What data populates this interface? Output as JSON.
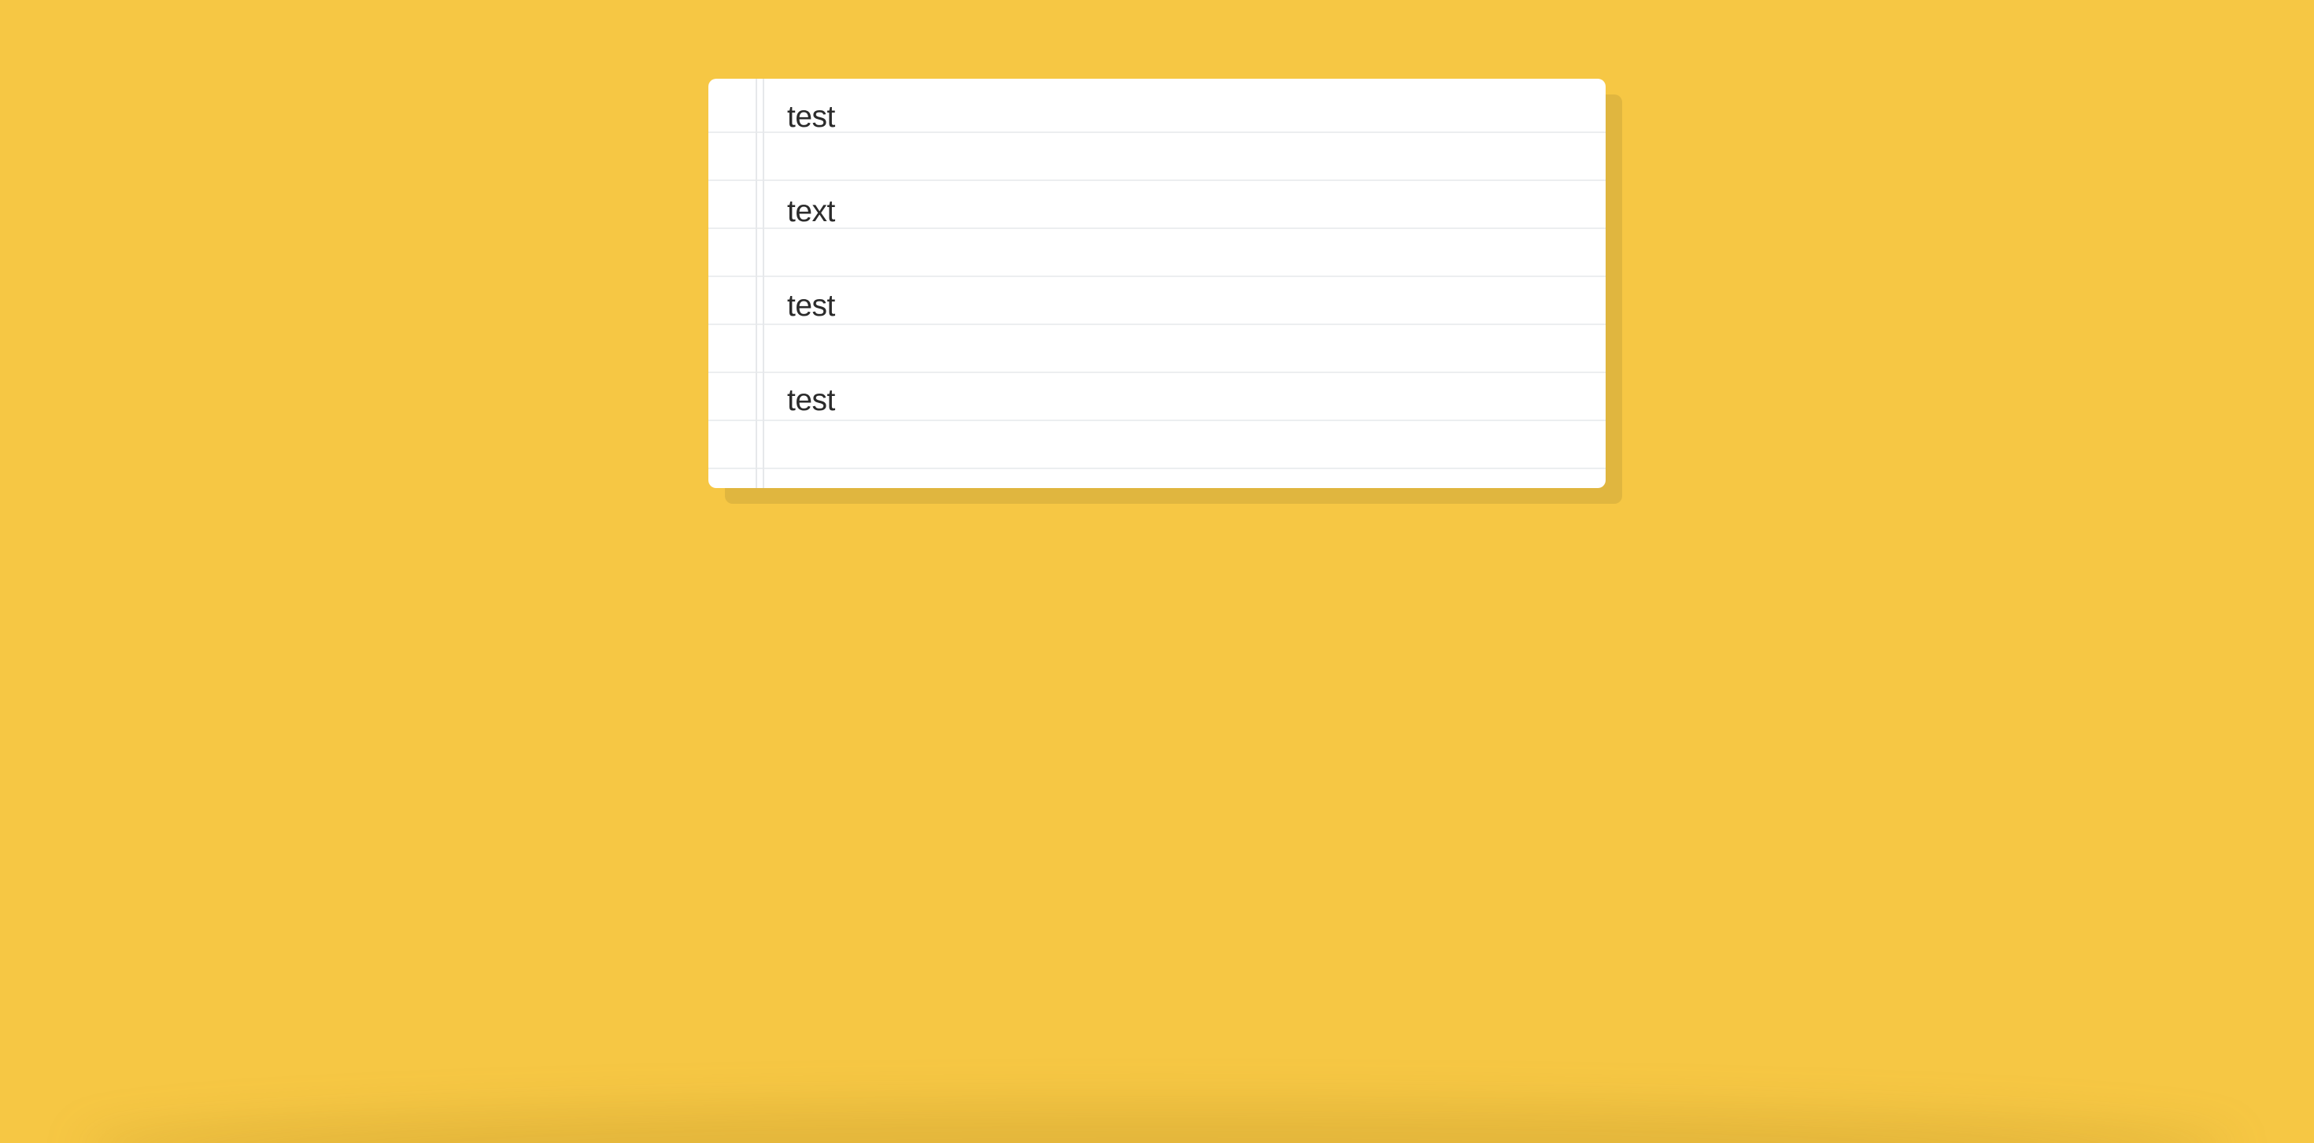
{
  "notes": {
    "items": [
      {
        "text": "test"
      },
      {
        "text": "text"
      },
      {
        "text": "test"
      },
      {
        "text": "test"
      }
    ]
  },
  "colors": {
    "background": "#F6C744",
    "paper": "#FFFFFF",
    "paper_shadow": "#E0B63F",
    "rule_line": "#ECEEF0",
    "text": "#2B2B2B"
  }
}
